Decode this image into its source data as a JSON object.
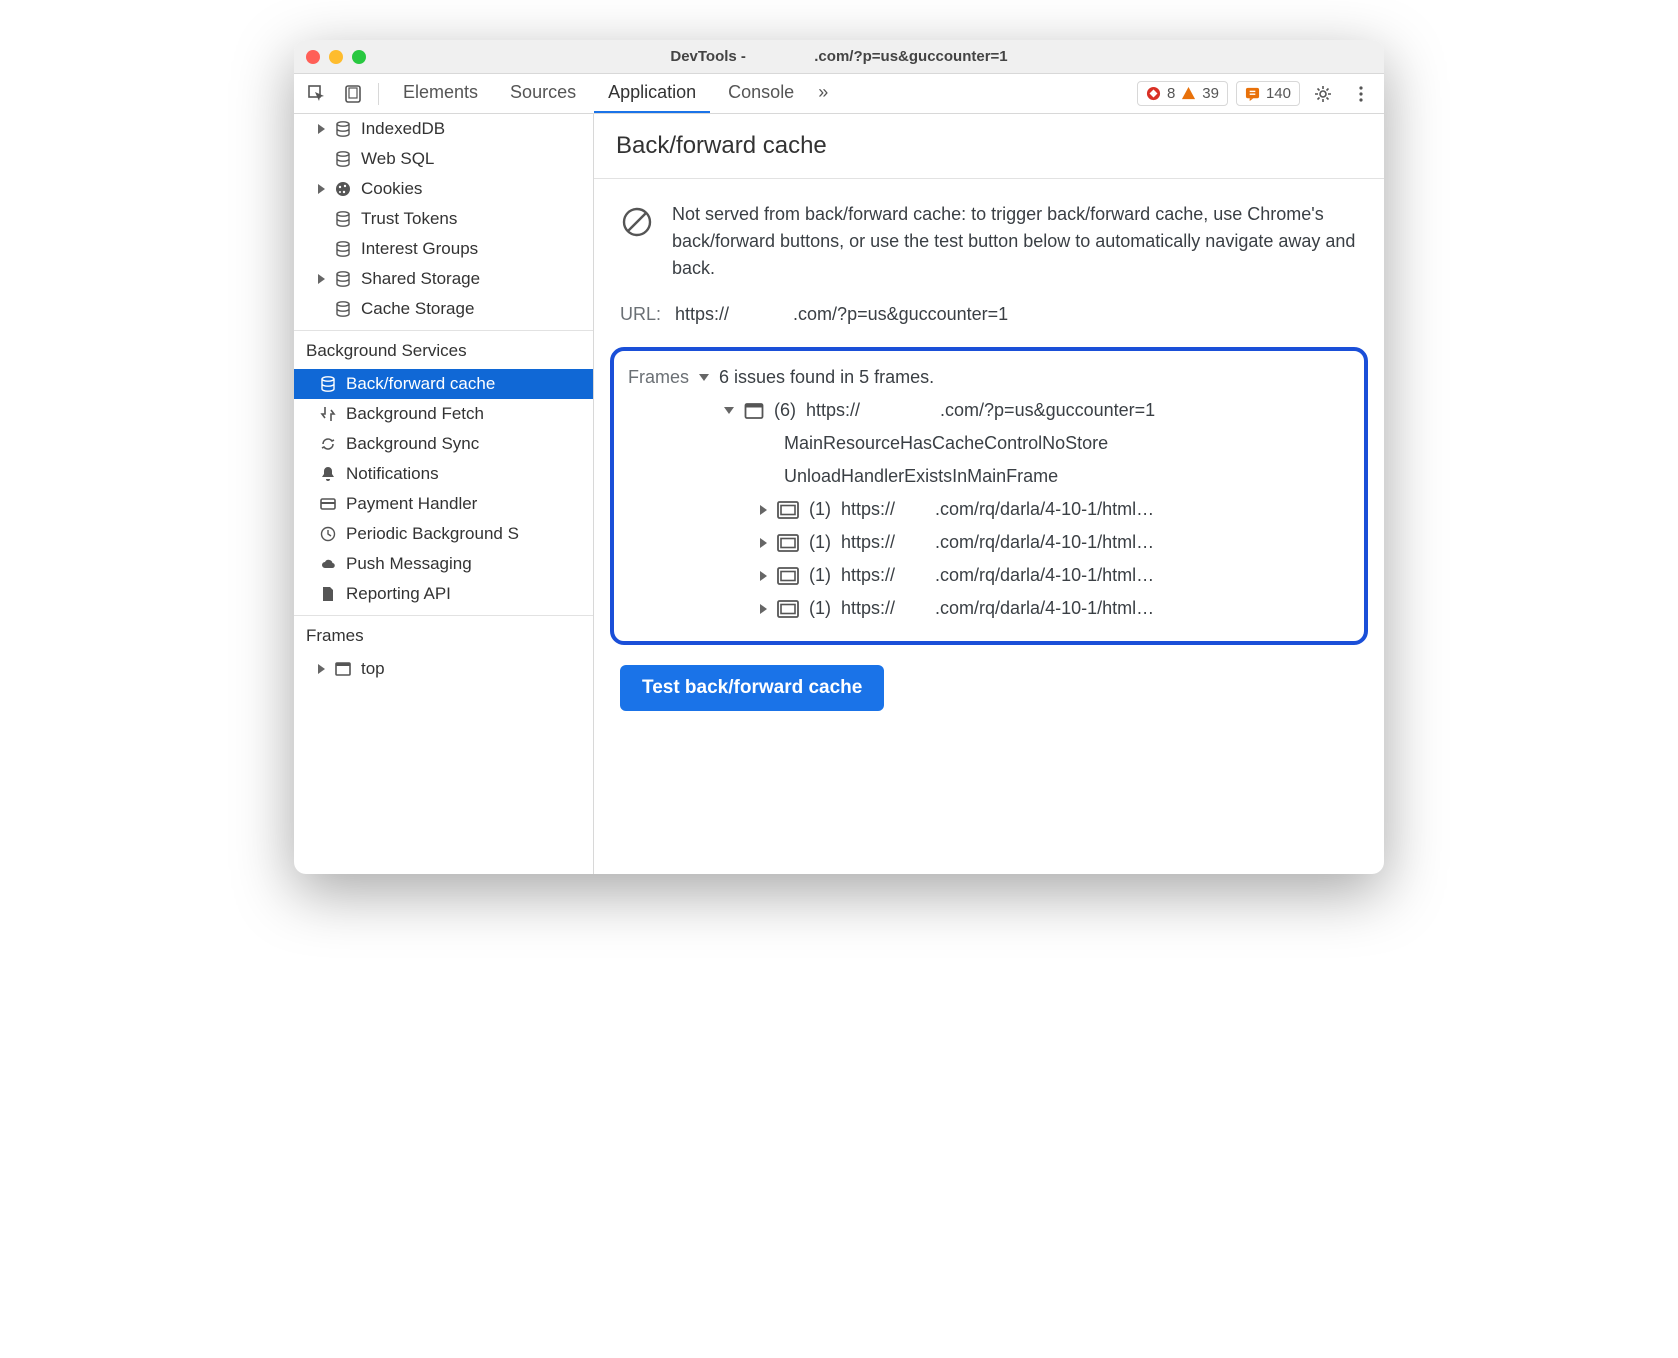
{
  "titlebar": {
    "title_prefix": "DevTools - ",
    "title_suffix": ".com/?p=us&guccounter=1"
  },
  "tabs": {
    "items": [
      "Elements",
      "Sources",
      "Application",
      "Console"
    ],
    "active": "Application",
    "more": "»"
  },
  "status": {
    "errors": "8",
    "warnings": "39",
    "issues": "140"
  },
  "sidebar": {
    "storage": [
      {
        "label": "IndexedDB",
        "icon": "db",
        "expandable": true
      },
      {
        "label": "Web SQL",
        "icon": "db",
        "expandable": false
      },
      {
        "label": "Cookies",
        "icon": "cookie",
        "expandable": true
      },
      {
        "label": "Trust Tokens",
        "icon": "db",
        "expandable": false
      },
      {
        "label": "Interest Groups",
        "icon": "db",
        "expandable": false
      },
      {
        "label": "Shared Storage",
        "icon": "db",
        "expandable": true
      },
      {
        "label": "Cache Storage",
        "icon": "db",
        "expandable": false
      }
    ],
    "bg_header": "Background Services",
    "bg": [
      {
        "label": "Back/forward cache",
        "icon": "db",
        "active": true
      },
      {
        "label": "Background Fetch",
        "icon": "fetch"
      },
      {
        "label": "Background Sync",
        "icon": "sync"
      },
      {
        "label": "Notifications",
        "icon": "bell"
      },
      {
        "label": "Payment Handler",
        "icon": "card"
      },
      {
        "label": "Periodic Background S",
        "icon": "clock"
      },
      {
        "label": "Push Messaging",
        "icon": "cloud"
      },
      {
        "label": "Reporting API",
        "icon": "file"
      }
    ],
    "frames_header": "Frames",
    "frames_item": "top"
  },
  "main": {
    "title": "Back/forward cache",
    "info": "Not served from back/forward cache: to trigger back/forward cache, use Chrome's back/forward buttons, or use the test button below to automatically navigate away and back.",
    "url_label": "URL:",
    "url_prefix": "https://",
    "url_suffix": ".com/?p=us&guccounter=1",
    "frames_label": "Frames",
    "frames_summary": "6 issues found in 5 frames.",
    "root_count": "(6)",
    "root_url_prefix": "https://",
    "root_url_suffix": ".com/?p=us&guccounter=1",
    "reasons": [
      "MainResourceHasCacheControlNoStore",
      "UnloadHandlerExistsInMainFrame"
    ],
    "child_frames": [
      {
        "count": "(1)",
        "url_prefix": "https://",
        "url_suffix": ".com/rq/darla/4-10-1/html…"
      },
      {
        "count": "(1)",
        "url_prefix": "https://",
        "url_suffix": ".com/rq/darla/4-10-1/html…"
      },
      {
        "count": "(1)",
        "url_prefix": "https://",
        "url_suffix": ".com/rq/darla/4-10-1/html…"
      },
      {
        "count": "(1)",
        "url_prefix": "https://",
        "url_suffix": ".com/rq/darla/4-10-1/html…"
      }
    ],
    "test_button": "Test back/forward cache"
  }
}
